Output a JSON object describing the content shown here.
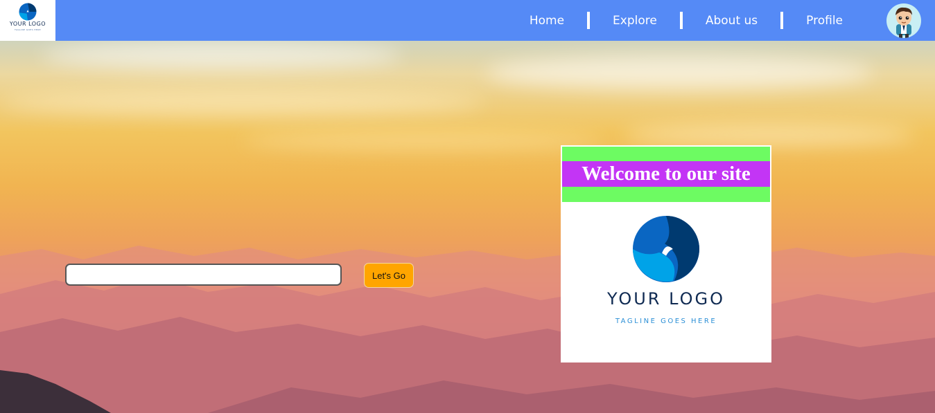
{
  "nav": {
    "logo": {
      "text": "YOUR LOGO",
      "tagline": "TAGLINE GOES HERE"
    },
    "links": [
      {
        "label": "Home"
      },
      {
        "label": "Explore"
      },
      {
        "label": "About us"
      },
      {
        "label": "Profile"
      }
    ],
    "avatar_icon": "cartoon-boy-avatar"
  },
  "search": {
    "value": "",
    "placeholder": "",
    "button_label": "Let's Go"
  },
  "card": {
    "title": "Welcome to our site",
    "logo_text": "YOUR LOGO",
    "logo_tagline": "TAGLINE GOES HERE"
  },
  "colors": {
    "navbar": "#558af6",
    "button": "#ffa500",
    "banner_green": "#6dfb62",
    "banner_purple": "#c335f5",
    "logo_navy": "#0f2a52",
    "logo_blue": "#2b8fd6"
  }
}
